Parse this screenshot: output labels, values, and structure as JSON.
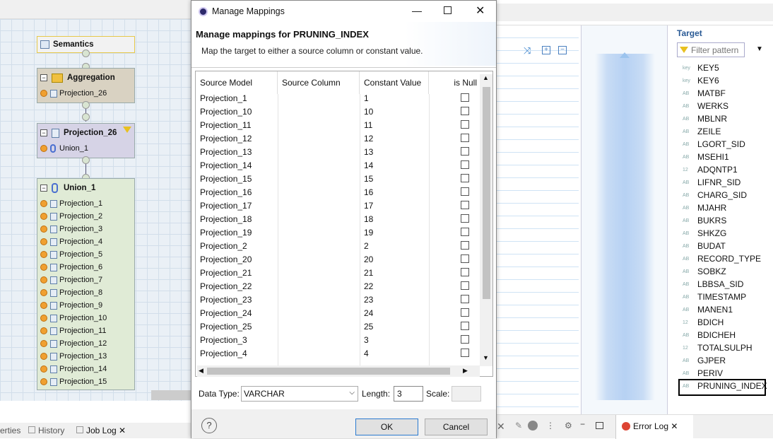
{
  "left": {
    "tab_partial": "erties",
    "tabs": [
      "History",
      "Job Log"
    ],
    "nodes": {
      "semantics": "Semantics",
      "aggregation": "Aggregation",
      "aggregation_input": "Projection_26",
      "projection26": "Projection_26",
      "projection26_input": "Union_1",
      "union": "Union_1",
      "union_inputs": [
        "Projection_1",
        "Projection_2",
        "Projection_3",
        "Projection_4",
        "Projection_5",
        "Projection_6",
        "Projection_7",
        "Projection_8",
        "Projection_9",
        "Projection_10",
        "Projection_11",
        "Projection_12",
        "Projection_13",
        "Projection_14",
        "Projection_15"
      ]
    }
  },
  "dialog": {
    "title": "Manage Mappings",
    "heading": "Manage mappings for PRUNING_INDEX",
    "subtitle": "Map the target to either a source column or constant value.",
    "columns": [
      "Source Model",
      "Source Column",
      "Constant Value",
      "is Null"
    ],
    "rows": [
      {
        "model": "Projection_1",
        "column": "",
        "constant": "1"
      },
      {
        "model": "Projection_10",
        "column": "",
        "constant": "10"
      },
      {
        "model": "Projection_11",
        "column": "",
        "constant": "11"
      },
      {
        "model": "Projection_12",
        "column": "",
        "constant": "12"
      },
      {
        "model": "Projection_13",
        "column": "",
        "constant": "13"
      },
      {
        "model": "Projection_14",
        "column": "",
        "constant": "14"
      },
      {
        "model": "Projection_15",
        "column": "",
        "constant": "15"
      },
      {
        "model": "Projection_16",
        "column": "",
        "constant": "16"
      },
      {
        "model": "Projection_17",
        "column": "",
        "constant": "17"
      },
      {
        "model": "Projection_18",
        "column": "",
        "constant": "18"
      },
      {
        "model": "Projection_19",
        "column": "",
        "constant": "19"
      },
      {
        "model": "Projection_2",
        "column": "",
        "constant": "2"
      },
      {
        "model": "Projection_20",
        "column": "",
        "constant": "20"
      },
      {
        "model": "Projection_21",
        "column": "",
        "constant": "21"
      },
      {
        "model": "Projection_22",
        "column": "",
        "constant": "22"
      },
      {
        "model": "Projection_23",
        "column": "",
        "constant": "23"
      },
      {
        "model": "Projection_24",
        "column": "",
        "constant": "24"
      },
      {
        "model": "Projection_25",
        "column": "",
        "constant": "25"
      },
      {
        "model": "Projection_3",
        "column": "",
        "constant": "3"
      },
      {
        "model": "Projection_4",
        "column": "",
        "constant": "4"
      }
    ],
    "data_type_label": "Data Type:",
    "data_type_value": "VARCHAR",
    "length_label": "Length:",
    "length_value": "3",
    "scale_label": "Scale:",
    "scale_value": "",
    "ok_label": "OK",
    "cancel_label": "Cancel",
    "help_icon": "?"
  },
  "right": {
    "target_title": "Target",
    "filter_placeholder": "Filter pattern",
    "fields": [
      {
        "type": "key",
        "name": "KEY5"
      },
      {
        "type": "key",
        "name": "KEY6"
      },
      {
        "type": "AB",
        "name": "MATBF"
      },
      {
        "type": "AB",
        "name": "WERKS"
      },
      {
        "type": "AB",
        "name": "MBLNR"
      },
      {
        "type": "AB",
        "name": "ZEILE"
      },
      {
        "type": "AB",
        "name": "LGORT_SID"
      },
      {
        "type": "AB",
        "name": "MSEHI1"
      },
      {
        "type": "12",
        "name": "ADQNTP1"
      },
      {
        "type": "AB",
        "name": "LIFNR_SID"
      },
      {
        "type": "AB",
        "name": "CHARG_SID"
      },
      {
        "type": "AB",
        "name": "MJAHR"
      },
      {
        "type": "AB",
        "name": "BUKRS"
      },
      {
        "type": "AB",
        "name": "SHKZG"
      },
      {
        "type": "AB",
        "name": "BUDAT"
      },
      {
        "type": "AB",
        "name": "RECORD_TYPE"
      },
      {
        "type": "AB",
        "name": "SOBKZ"
      },
      {
        "type": "AB",
        "name": "LBBSA_SID"
      },
      {
        "type": "AB",
        "name": "TIMESTAMP"
      },
      {
        "type": "AB",
        "name": "MANEN1"
      },
      {
        "type": "12",
        "name": "BDICH"
      },
      {
        "type": "AB",
        "name": "BDICHEH"
      },
      {
        "type": "12",
        "name": "TOTALSULPH"
      },
      {
        "type": "AB",
        "name": "GJPER"
      },
      {
        "type": "AB",
        "name": "PERIV"
      },
      {
        "type": "AB",
        "name": "PRUNING_INDEX"
      }
    ],
    "error_log_tab": "Error Log"
  }
}
